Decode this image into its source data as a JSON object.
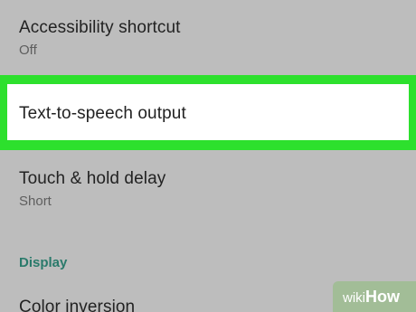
{
  "settings": {
    "accessibility_shortcut": {
      "title": "Accessibility shortcut",
      "summary": "Off"
    },
    "text_to_speech": {
      "title": "Text-to-speech output"
    },
    "touch_hold_delay": {
      "title": "Touch & hold delay",
      "summary": "Short"
    },
    "display_category": {
      "label": "Display"
    },
    "color_inversion": {
      "title": "Color inversion"
    }
  },
  "watermark": {
    "prefix": "wiki",
    "suffix": "How"
  },
  "colors": {
    "background": "#bdbdbd",
    "highlight": "#2de02d",
    "highlighted_row": "#ffffff",
    "category_accent": "#2a7a6b"
  }
}
